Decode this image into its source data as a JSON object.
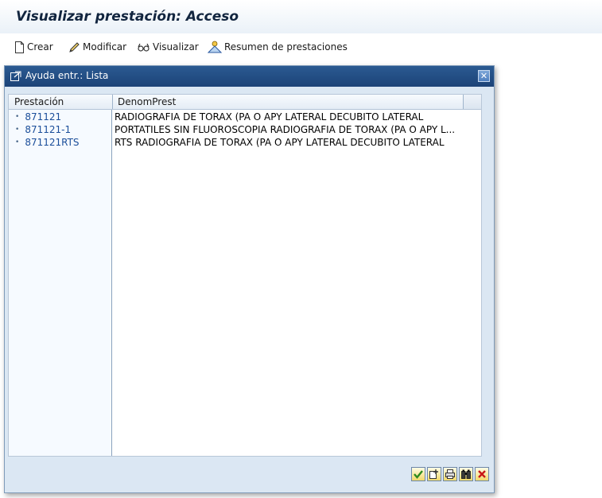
{
  "window": {
    "title": "Visualizar prestación: Acceso"
  },
  "toolbar": {
    "crear": "Crear",
    "modificar": "Modificar",
    "visualizar": "Visualizar",
    "resumen": "Resumen de prestaciones"
  },
  "dialog": {
    "title": "Ayuda entr.: Lista",
    "close_glyph": "✕",
    "columns": [
      "Prestación",
      "DenomPrest"
    ],
    "rows": [
      {
        "code": "871121",
        "desc": "RADIOGRAFIA DE TORAX (PA O APY LATERAL DECUBITO LATERAL"
      },
      {
        "code": "871121-1",
        "desc": "PORTATILES SIN FLUOROSCOPIA RADIOGRAFIA DE TORAX (PA O APY L..."
      },
      {
        "code": "871121RTS",
        "desc": "RTS RADIOGRAFIA DE TORAX (PA O APY LATERAL DECUBITO LATERAL"
      }
    ],
    "footer_buttons": [
      "confirm-icon",
      "new-entry-icon",
      "print-icon",
      "find-icon",
      "cancel-icon"
    ]
  },
  "colors": {
    "title_text": "#12253f",
    "dialog_header": "#1c4378",
    "dialog_body": "#dbe7f3",
    "link_text": "#1b4e9a",
    "confirm_green": "#2e8b1e",
    "cancel_red": "#c81818"
  }
}
